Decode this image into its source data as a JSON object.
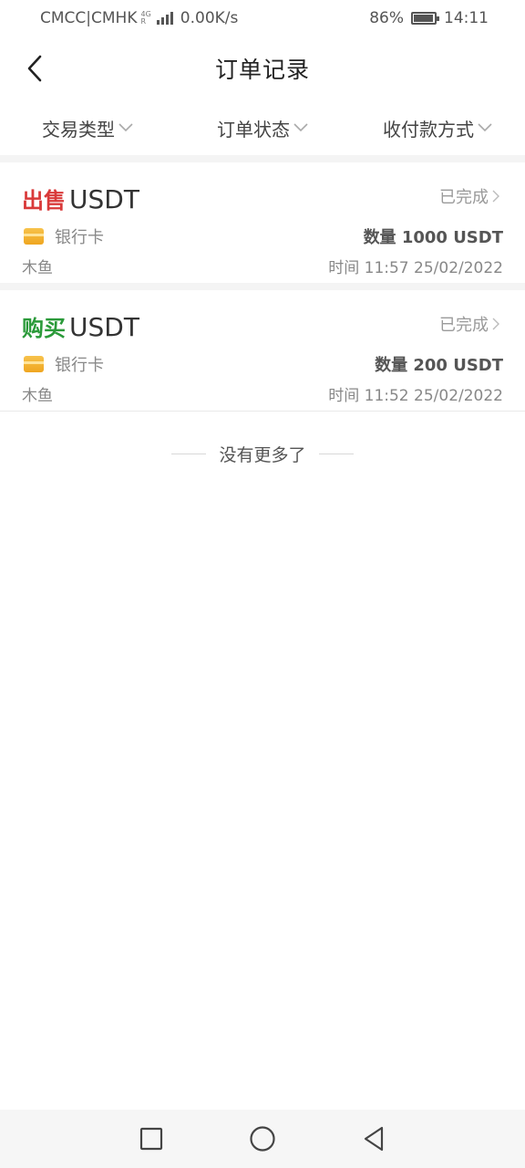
{
  "status_bar": {
    "carrier": "CMCC|CMHK",
    "network_tag_top": "4G",
    "network_tag_bottom": "R",
    "speed": "0.00K/s",
    "battery_percent_text": "86%",
    "battery_level": 0.86,
    "time": "14:11"
  },
  "header": {
    "title": "订单记录",
    "back_icon": "chevron-left-icon"
  },
  "filters": [
    {
      "label": "交易类型"
    },
    {
      "label": "订单状态"
    },
    {
      "label": "收付款方式"
    }
  ],
  "orders": [
    {
      "type": "出售",
      "type_color": "#d93a3a",
      "asset": "USDT",
      "status": "已完成",
      "payment_method": "银行卡",
      "quantity": "数量 1000 USDT",
      "counterparty": "木鱼",
      "time": "时间 11:57 25/02/2022"
    },
    {
      "type": "购买",
      "type_color": "#2b9a3a",
      "asset": "USDT",
      "status": "已完成",
      "payment_method": "银行卡",
      "quantity": "数量 200 USDT",
      "counterparty": "木鱼",
      "time": "时间 11:52 25/02/2022"
    }
  ],
  "footer_text": "没有更多了",
  "nav": {
    "recent_icon": "square-icon",
    "home_icon": "circle-icon",
    "back_icon": "triangle-back-icon"
  }
}
